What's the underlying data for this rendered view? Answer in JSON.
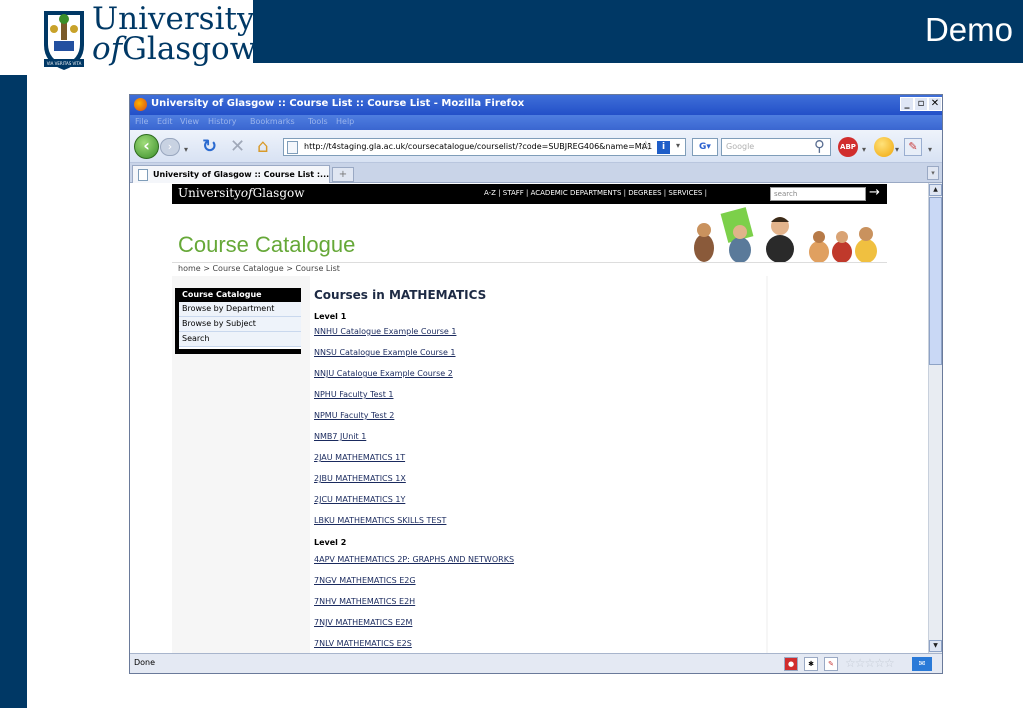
{
  "slide": {
    "logo_line1": "University",
    "logo_of": "of",
    "logo_line2": "Glasgow",
    "crest_motto": "VIA VERITAS VITA",
    "title": "Demo",
    "brand_color": "#003865"
  },
  "browser": {
    "window_title": "University of Glasgow :: Course List :: Course List - Mozilla Firefox",
    "menu": [
      "File",
      "Edit",
      "View",
      "History",
      "Bookmarks",
      "Tools",
      "Help"
    ],
    "url": "http://t4staging.gla.ac.uk/coursecatalogue/courselist/?code=SUBJREG406&name=MA1",
    "search_placeholder": "Google",
    "tab_label": "University of Glasgow :: Course List :...",
    "status_text": "Done",
    "abp_label": "ABP"
  },
  "site": {
    "logo_pre": "University",
    "logo_of": "of",
    "logo_post": "Glasgow",
    "nav": "A-Z  |  STAFF  |  ACADEMIC DEPARTMENTS  |  DEGREES  |  SERVICES  |",
    "search_placeholder": "search",
    "banner_title": "Course Catalogue",
    "breadcrumb": "home > Course Catalogue > Course List",
    "menu_header": "Course Catalogue",
    "menu_items": [
      "Browse by Department",
      "Browse by Subject",
      "Search"
    ],
    "main_title": "Courses in MATHEMATICS",
    "level1_label": "Level 1",
    "level1_courses": [
      "NNHU Catalogue Example Course 1",
      "NNSU Catalogue Example Course 1",
      "NNJU Catalogue Example Course 2",
      "NPHU Faculty Test 1",
      "NPMU Faculty Test 2",
      "NMB7 JUnit 1",
      "2JAU MATHEMATICS 1T",
      "2JBU MATHEMATICS 1X",
      "2JCU MATHEMATICS 1Y",
      "LBKU MATHEMATICS SKILLS TEST"
    ],
    "level2_label": "Level 2",
    "level2_courses": [
      "4APV MATHEMATICS 2P: GRAPHS AND NETWORKS",
      "7NGV MATHEMATICS E2G",
      "7NHV MATHEMATICS E2H",
      "7NJV MATHEMATICS E2M",
      "7NLV MATHEMATICS E2S"
    ],
    "accent_green": "#66a838"
  }
}
